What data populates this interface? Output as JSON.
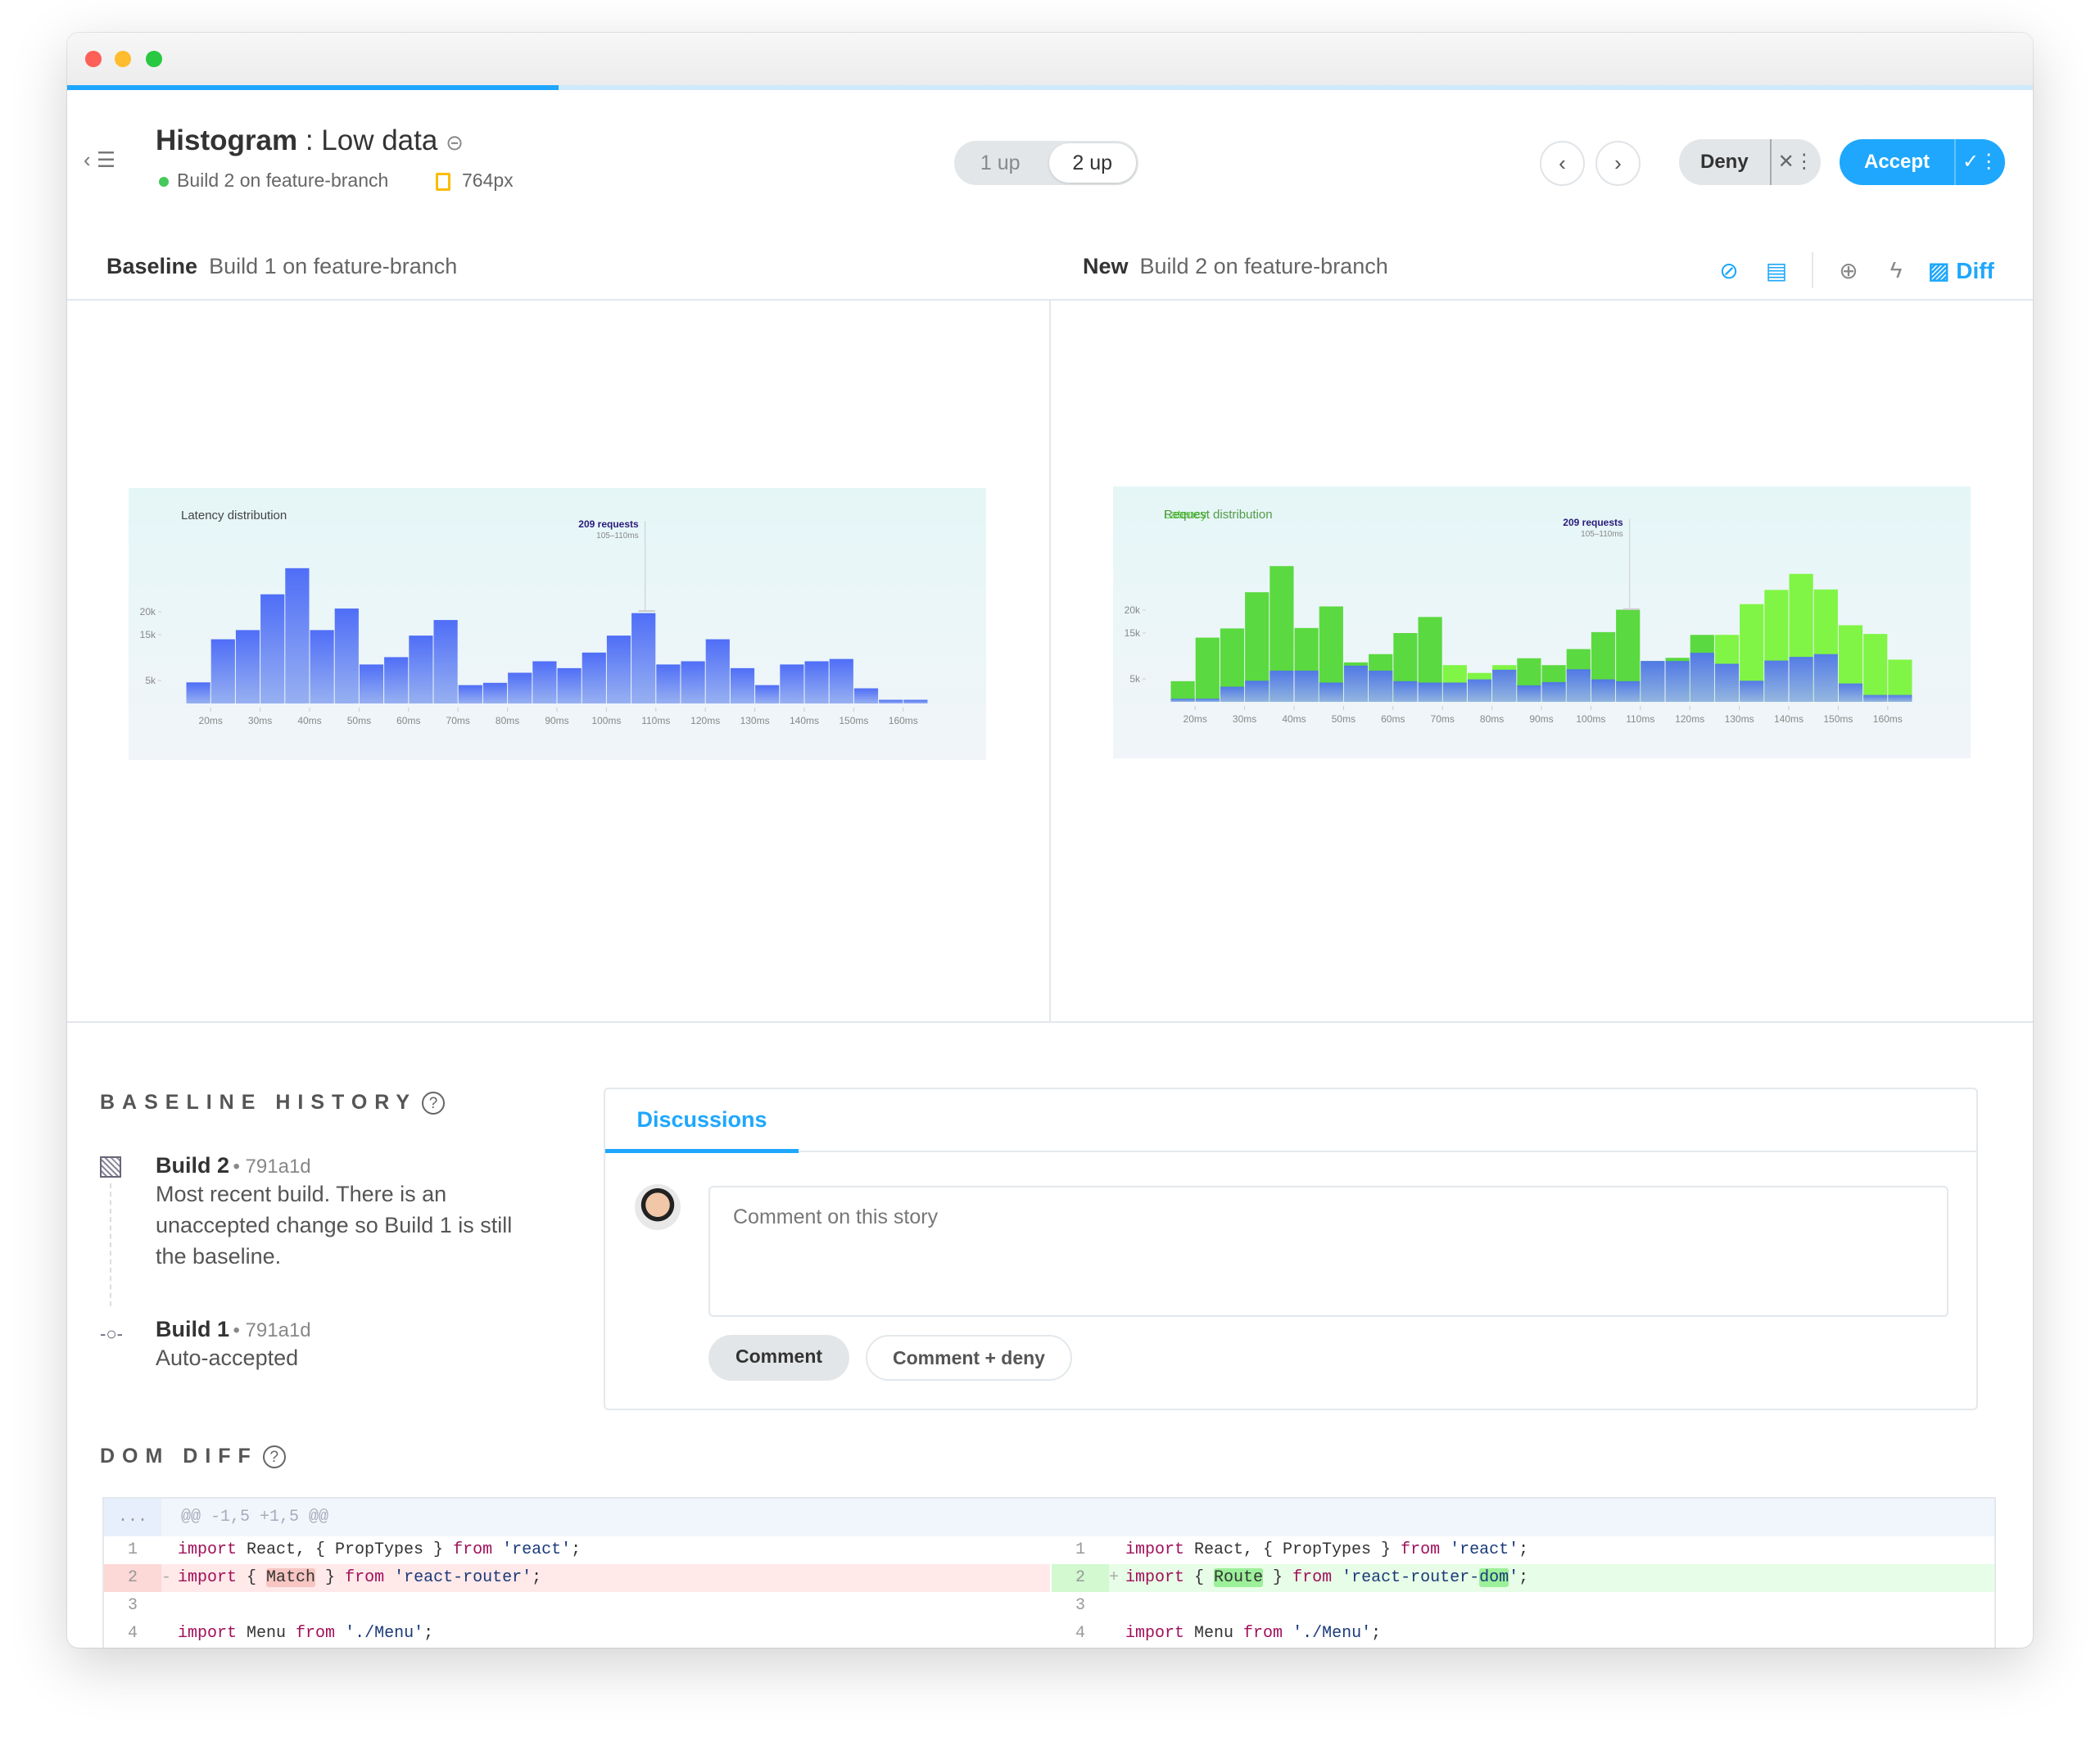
{
  "window": {
    "traffic_lights": [
      "#fe5f57",
      "#febc2e",
      "#28c840"
    ],
    "progress_percent": 25
  },
  "header": {
    "title_component": "Histogram",
    "title_separator": " : ",
    "title_story": "Low data",
    "build_status": "Build 2 on feature-branch",
    "build_status_color": "#44c95a",
    "viewport": "764px",
    "view_toggle": [
      "1 up",
      "2 up"
    ],
    "view_selected": "2 up",
    "deny_label": "Deny",
    "accept_label": "Accept",
    "accent": "#1ea7fd"
  },
  "compare": {
    "baseline_label": "Baseline",
    "baseline_build": "Build 1 on feature-branch",
    "new_label": "New",
    "new_build": "Build 2 on feature-branch",
    "diff_label": "Diff"
  },
  "chart_data": [
    {
      "type": "bar",
      "title": "Latency distribution",
      "x_bin_start_ms": 15,
      "bin_width_ms": 5,
      "x_ticks": [
        "20ms",
        "30ms",
        "40ms",
        "50ms",
        "60ms",
        "70ms",
        "80ms",
        "90ms",
        "100ms",
        "110ms",
        "120ms",
        "130ms",
        "140ms",
        "150ms",
        "160ms"
      ],
      "y_ticks": [
        {
          "label": "5k",
          "value": 5
        },
        {
          "label": "15k",
          "value": 15
        },
        {
          "label": "20k",
          "value": 20
        }
      ],
      "ylim": [
        0,
        31
      ],
      "values": [
        4.6,
        14.0,
        16.0,
        23.8,
        29.5,
        16.0,
        20.7,
        8.5,
        10.1,
        14.8,
        18.2,
        4.0,
        4.5,
        6.7,
        9.2,
        7.7,
        11.1,
        14.8,
        19.7,
        8.5,
        9.2,
        14.0,
        7.7,
        4.0,
        8.5,
        9.2,
        9.7,
        3.3,
        0.8,
        0.8
      ],
      "annotation": {
        "label": "209 requests",
        "range": "105–110ms"
      },
      "colors": {
        "bar_top": "#4f6ef7",
        "bar_bottom": "#97b0f1"
      }
    },
    {
      "type": "bar",
      "title": "Request distribution",
      "title_ghost": "Latency",
      "x_bin_start_ms": 15,
      "bin_width_ms": 5,
      "x_ticks": [
        "20ms",
        "30ms",
        "40ms",
        "50ms",
        "60ms",
        "70ms",
        "80ms",
        "90ms",
        "100ms",
        "110ms",
        "120ms",
        "130ms",
        "140ms",
        "150ms",
        "160ms"
      ],
      "y_ticks": [
        {
          "label": "5k",
          "value": 5
        },
        {
          "label": "15k",
          "value": 15
        },
        {
          "label": "20k",
          "value": 20
        }
      ],
      "ylim": [
        0,
        31
      ],
      "series": [
        {
          "values": [
            0.7,
            0.7,
            3.3,
            4.6,
            6.8,
            6.8,
            4.2,
            7.9,
            6.8,
            4.5,
            4.2,
            4.2,
            4.9,
            7.0,
            3.6,
            4.3,
            7.1,
            4.9,
            4.5,
            8.9,
            8.9,
            10.7,
            8.3,
            4.6,
            9.0,
            9.8,
            10.4,
            4.0,
            1.5,
            1.5
          ]
        },
        {
          "values": [
            4.5,
            14.0,
            16.0,
            23.9,
            29.6,
            16.1,
            20.8,
            8.6,
            10.4,
            15.0,
            18.5,
            8.0,
            6.3,
            8.0,
            9.5,
            8.0,
            11.5,
            15.2,
            20.1,
            8.9,
            9.6,
            14.6,
            14.6,
            21.3,
            24.4,
            27.9,
            24.5,
            16.7,
            14.8,
            9.2
          ]
        }
      ],
      "diff_light": [
        12,
        13,
        14,
        23,
        24,
        25,
        26,
        27,
        28,
        29,
        30
      ],
      "annotation": {
        "label": "209 requests",
        "range": "105–110ms"
      },
      "colors": {
        "diff_dark": "#5bd940",
        "diff_light": "#80f545"
      }
    }
  ],
  "baseline_history": {
    "heading": "BASELINE HISTORY",
    "items": [
      {
        "build": "Build 2",
        "hash": "791a1d",
        "desc": "Most recent build. There is an unaccepted change so Build 1 is still the baseline."
      },
      {
        "build": "Build 1",
        "hash": "791a1d",
        "desc": "Auto-accepted"
      }
    ]
  },
  "discussions": {
    "tab": "Discussions",
    "placeholder": "Comment on this story",
    "comment_button": "Comment",
    "comment_deny_button": "Comment + deny"
  },
  "dom_diff": {
    "heading": "DOM DIFF",
    "hunk": "@@ -1,5 +1,5 @@",
    "expander": "...",
    "left": [
      {
        "n": "1",
        "code": "import React, { PropTypes } from 'react';"
      },
      {
        "n": "2",
        "marker": "-",
        "pre": "import { ",
        "hl": "Match",
        "post": " } from 'react-router';"
      },
      {
        "n": "3",
        "code": ""
      },
      {
        "n": "4",
        "code": "import Menu from './Menu';"
      }
    ],
    "right": [
      {
        "n": "1",
        "code": "import React, { PropTypes } from 'react';"
      },
      {
        "n": "2",
        "marker": "+",
        "pre": "import { ",
        "hl": "Route",
        "mid": " } from 'react-router-",
        "hl2": "dom",
        "post": "';"
      },
      {
        "n": "3",
        "code": ""
      },
      {
        "n": "4",
        "code": "import Menu from './Menu';"
      }
    ]
  }
}
